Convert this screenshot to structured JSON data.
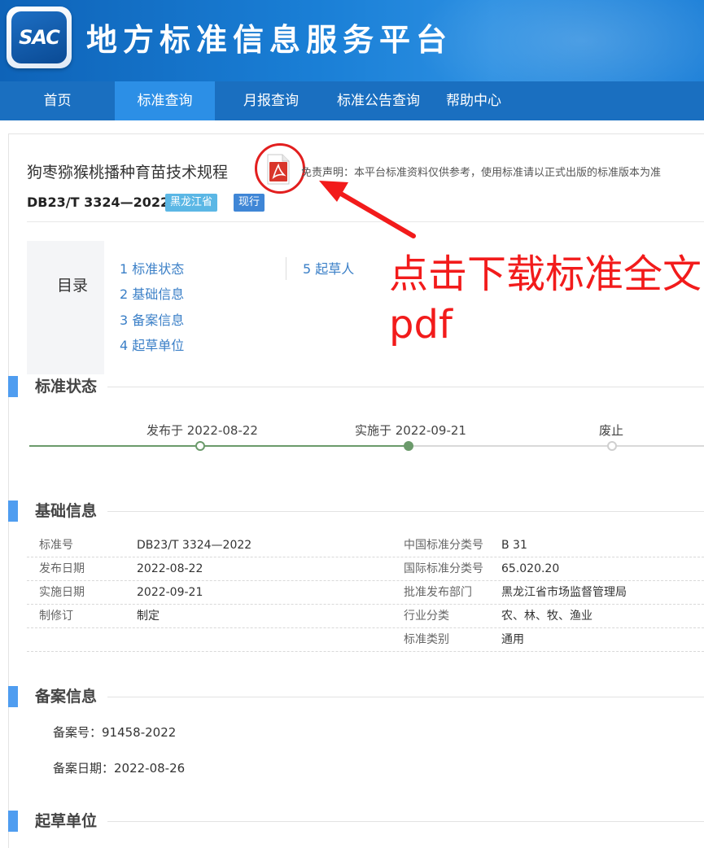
{
  "header": {
    "logo_text": "SAC",
    "title": "地方标准信息服务平台"
  },
  "nav": {
    "items": [
      "首页",
      "标准查询",
      "月报查询",
      "标准公告查询",
      "帮助中心"
    ],
    "active": "标准查询"
  },
  "standard": {
    "title": "狗枣猕猴桃播种育苗技术规程",
    "pdf_icon": "pdf-icon",
    "disclaimer": "免责声明：本平台标准资料仅供参考，使用标准请以正式出版的标准版本为准",
    "code": "DB23/T 3324—2022",
    "province": "黑龙江省",
    "status": "现行"
  },
  "toc": {
    "label": "目录",
    "items": [
      "1 标准状态",
      "2 基础信息",
      "3 备案信息",
      "4 起草单位",
      "5 起草人"
    ]
  },
  "annotation": {
    "text": "点击下载标准全文pdf",
    "color": "#f21b1b"
  },
  "sections": {
    "status": "标准状态",
    "basic": "基础信息",
    "record": "备案信息",
    "drafting_unit": "起草单位"
  },
  "timeline": {
    "published": "发布于 2022-08-22",
    "implemented": "实施于 2022-09-21",
    "abolished": "废止"
  },
  "basic_info": {
    "left": [
      {
        "key": "标准号",
        "value": "DB23/T 3324—2022"
      },
      {
        "key": "发布日期",
        "value": "2022-08-22"
      },
      {
        "key": "实施日期",
        "value": "2022-09-21"
      },
      {
        "key": "制修订",
        "value": "制定"
      }
    ],
    "right": [
      {
        "key": "中国标准分类号",
        "value": "B 31"
      },
      {
        "key": "国际标准分类号",
        "value": "65.020.20"
      },
      {
        "key": "批准发布部门",
        "value": "黑龙江省市场监督管理局"
      },
      {
        "key": "行业分类",
        "value": "农、林、牧、渔业"
      },
      {
        "key": "标准类别",
        "value": "通用"
      }
    ]
  },
  "record_info": {
    "record_no": "备案号：91458-2022",
    "record_date": "备案日期：2022-08-26"
  },
  "colors": {
    "nav_bg": "#1a6fc0",
    "nav_active": "#2c8fe6",
    "accent_bar": "#4f9df0",
    "timeline_green": "#6b9a6b",
    "link": "#3a7fc7"
  }
}
